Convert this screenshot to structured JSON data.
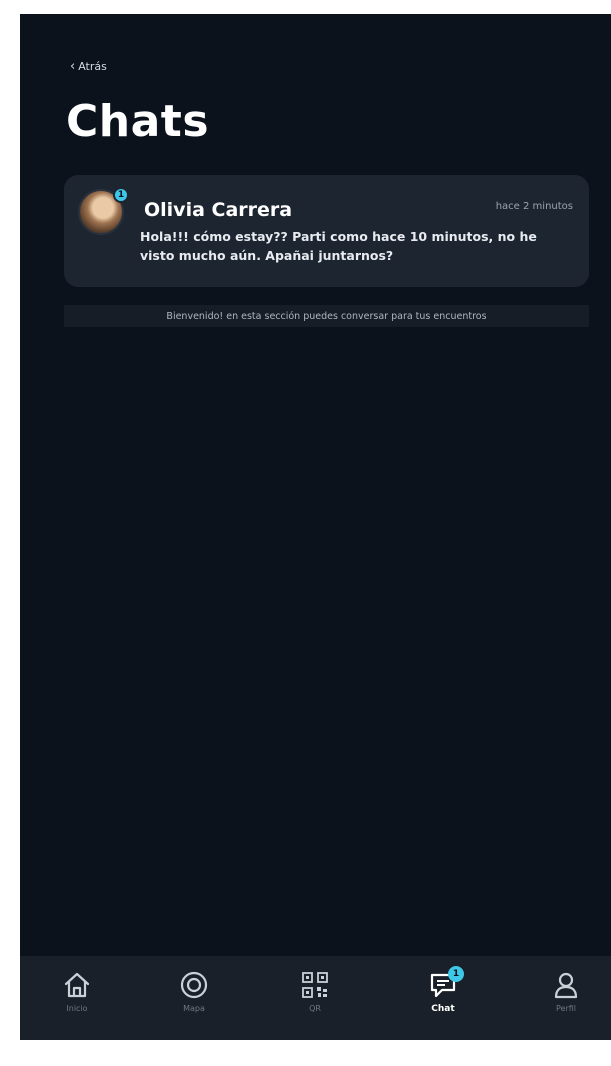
{
  "header": {
    "back_label": "Atrás",
    "title": "Chats"
  },
  "chats": [
    {
      "name": "Olivia Carrera",
      "time": "hace 2 minutos",
      "message": "Hola!!! cómo estay?? Parti como hace 10 minutos, no he visto mucho aún. Apañai juntarnos?",
      "unread": "1",
      "avatar": "profile-photo"
    }
  ],
  "info_text": "Bienvenido! en esta sección puedes conversar para tus encuentros",
  "nav": {
    "items": [
      {
        "label": "Inicio",
        "icon": "home-icon"
      },
      {
        "label": "Mapa",
        "icon": "target-icon"
      },
      {
        "label": "QR",
        "icon": "qr-icon"
      },
      {
        "label": "Chat",
        "icon": "chat-icon",
        "active": true,
        "badge": "1"
      },
      {
        "label": "Perfil",
        "icon": "user-icon"
      }
    ]
  },
  "colors": {
    "background": "#0b121c",
    "card": "#1d2530",
    "accent": "#3ec7e6",
    "nav_background": "#1a2029"
  }
}
